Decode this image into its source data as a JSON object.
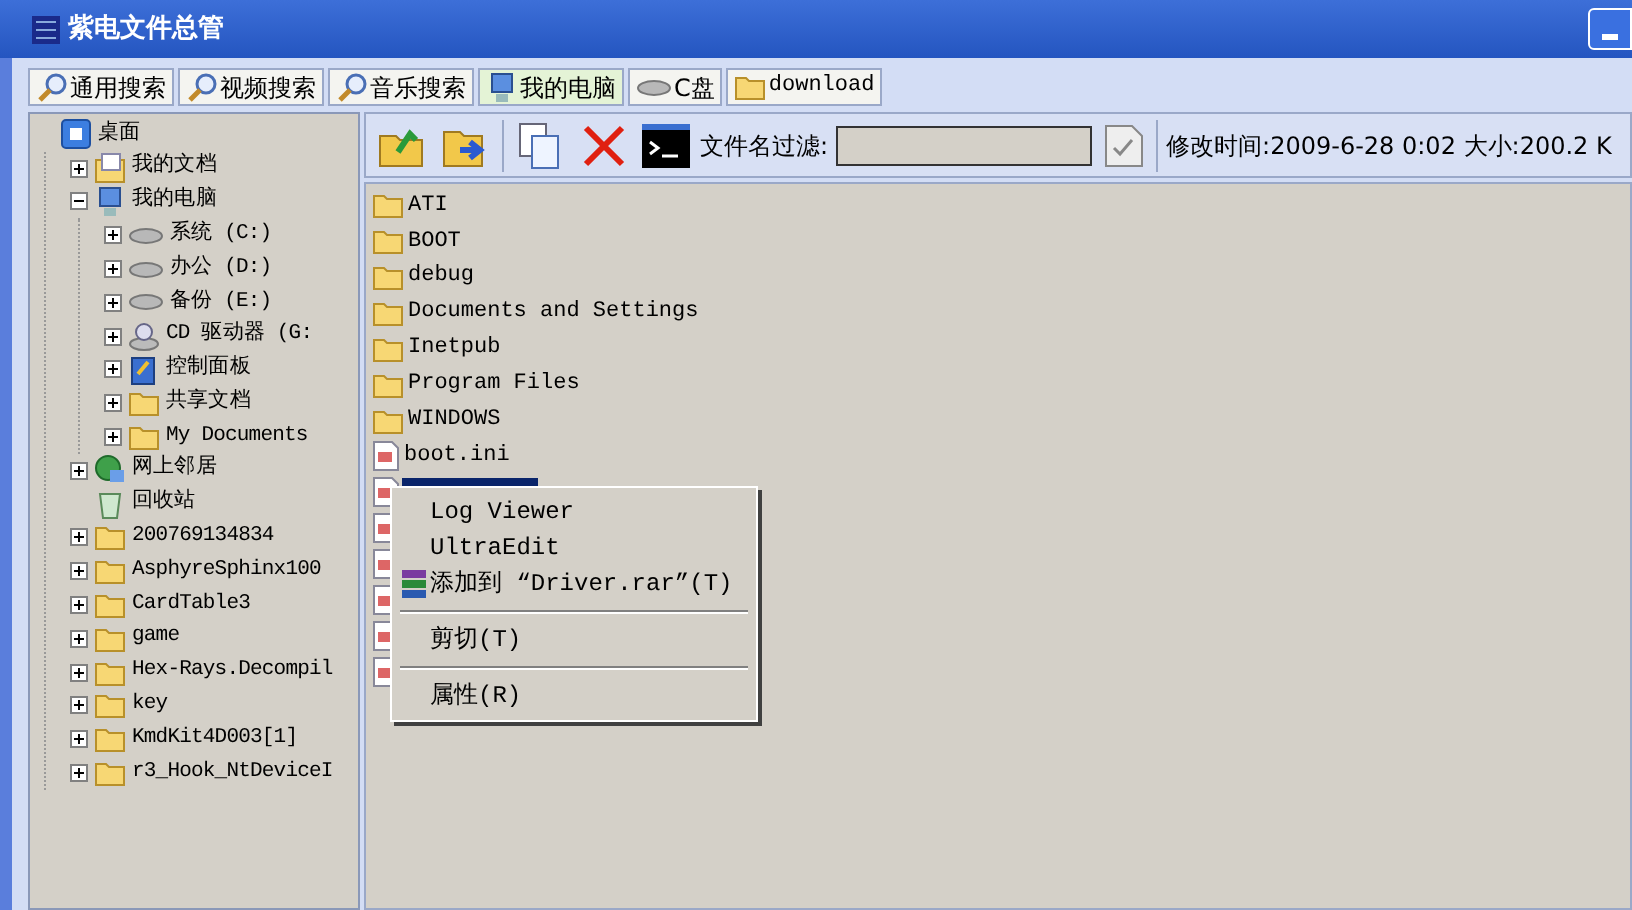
{
  "window": {
    "title": "紫电文件总管"
  },
  "tabs": [
    {
      "label": "通用搜索",
      "kind": "search",
      "selected": false
    },
    {
      "label": "视频搜索",
      "kind": "search",
      "selected": false
    },
    {
      "label": "音乐搜索",
      "kind": "search",
      "selected": false
    },
    {
      "label": "我的电脑",
      "kind": "computer",
      "selected": true
    },
    {
      "label": "C盘",
      "kind": "drive",
      "selected": false
    },
    {
      "label": "download",
      "kind": "folder",
      "selected": false
    }
  ],
  "tree": [
    {
      "label": "桌面",
      "kind": "desktop",
      "children": [
        {
          "label": "我的文档",
          "kind": "docs",
          "expanded": false
        },
        {
          "label": "我的电脑",
          "kind": "computer",
          "expanded": true,
          "children": [
            {
              "label": "系统 (C:)",
              "kind": "drive",
              "expanded": false
            },
            {
              "label": "办公 (D:)",
              "kind": "drive",
              "expanded": false
            },
            {
              "label": "备份 (E:)",
              "kind": "drive",
              "expanded": false
            },
            {
              "label": "CD 驱动器 (G:",
              "kind": "cdrom",
              "expanded": false
            },
            {
              "label": "控制面板",
              "kind": "control",
              "expanded": false
            },
            {
              "label": "共享文档",
              "kind": "folder",
              "expanded": false
            },
            {
              "label": "My Documents",
              "kind": "folder",
              "expanded": false
            }
          ]
        },
        {
          "label": "网上邻居",
          "kind": "network",
          "expanded": false
        },
        {
          "label": "回收站",
          "kind": "recycle"
        },
        {
          "label": "200769134834",
          "kind": "folder",
          "expanded": false
        },
        {
          "label": "AsphyreSphinx100",
          "kind": "folder",
          "expanded": false
        },
        {
          "label": "CardTable3",
          "kind": "folder",
          "expanded": false
        },
        {
          "label": "game",
          "kind": "folder",
          "expanded": false
        },
        {
          "label": "Hex-Rays.Decompil",
          "kind": "folder",
          "expanded": false
        },
        {
          "label": "key",
          "kind": "folder",
          "expanded": false
        },
        {
          "label": "KmdKit4D003[1]",
          "kind": "folder",
          "expanded": false
        },
        {
          "label": "r3_Hook_NtDeviceI",
          "kind": "folder",
          "expanded": false
        }
      ]
    }
  ],
  "toolbar": {
    "filter_label": "文件名过滤:",
    "status": "修改时间:2009-6-28 0:02 大小:200.2 K"
  },
  "files": [
    {
      "name": "ATI",
      "kind": "folder",
      "selected": false
    },
    {
      "name": "BOOT",
      "kind": "folder",
      "selected": false
    },
    {
      "name": "debug",
      "kind": "folder",
      "selected": false
    },
    {
      "name": "Documents and Settings",
      "kind": "folder",
      "selected": false
    },
    {
      "name": "Inetpub",
      "kind": "folder",
      "selected": false
    },
    {
      "name": "Program Files",
      "kind": "folder",
      "selected": false
    },
    {
      "name": "WINDOWS",
      "kind": "folder",
      "selected": false
    },
    {
      "name": "boot.ini",
      "kind": "file",
      "selected": false
    },
    {
      "kind": "file",
      "selected": true
    }
  ],
  "covered_files": [
    {
      "kind": "file"
    },
    {
      "kind": "file"
    },
    {
      "kind": "file"
    },
    {
      "kind": "file"
    },
    {
      "kind": "file"
    }
  ],
  "context_menu": [
    {
      "kind": "item",
      "label": "Log Viewer"
    },
    {
      "kind": "item",
      "label": "UltraEdit"
    },
    {
      "kind": "archive",
      "label": "添加到 “Driver.rar”(T)"
    },
    {
      "kind": "separator"
    },
    {
      "kind": "item",
      "label": "剪切(T)"
    },
    {
      "kind": "separator"
    },
    {
      "kind": "item",
      "label": "属性(R)"
    }
  ]
}
